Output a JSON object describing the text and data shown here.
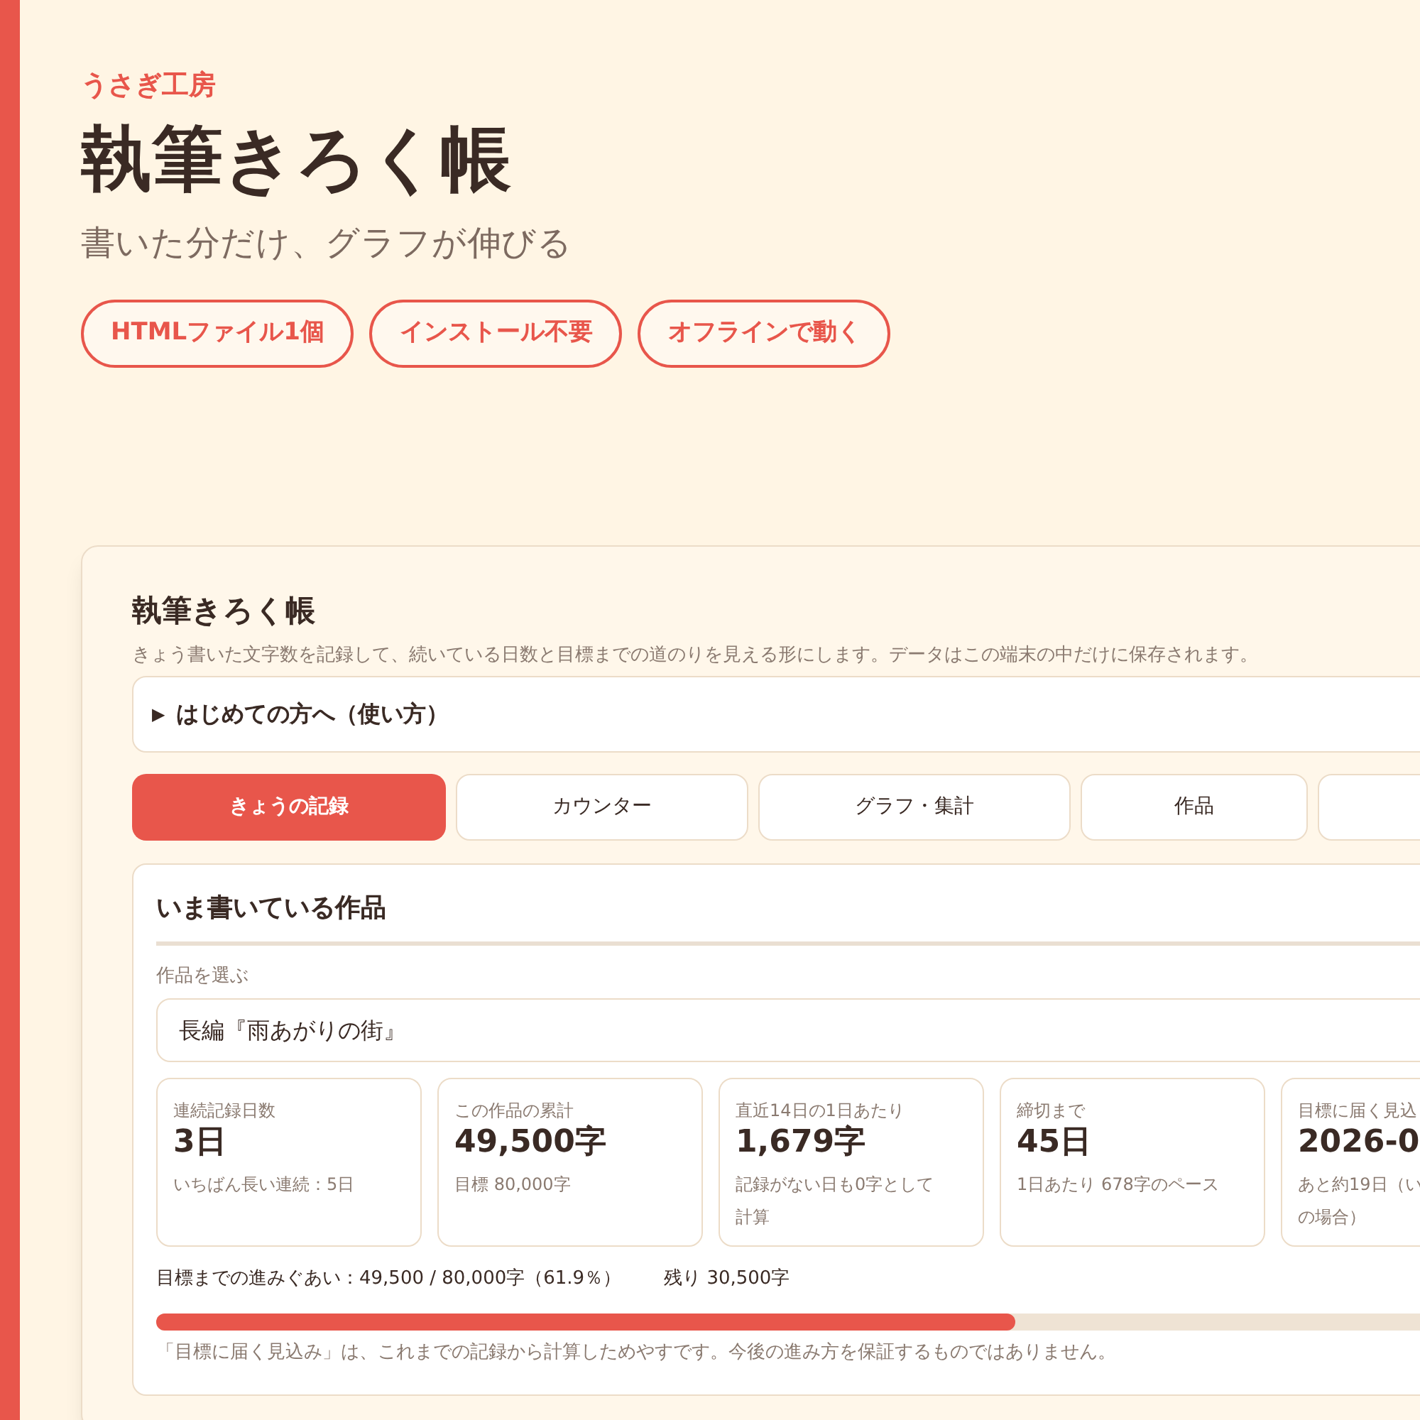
{
  "hero": {
    "brand": "うさぎ工房",
    "title": "執筆きろく帳",
    "subtitle": "書いた分だけ、グラフが伸びる",
    "badges": [
      "HTMLファイル1個",
      "インストール不要",
      "オフラインで動く"
    ]
  },
  "app": {
    "title": "執筆きろく帳",
    "description": "きょう書いた文字数を記録して、続いている日数と目標までの道のりを見える形にします。データはこの端末の中だけに保存されます。",
    "help": {
      "marker": "▶",
      "label": "はじめての方へ（使い方）"
    },
    "tabs": [
      {
        "label": "きょうの記録",
        "selected": true
      },
      {
        "label": "カウンター",
        "selected": false
      },
      {
        "label": "グラフ・集計",
        "selected": false
      },
      {
        "label": "作品",
        "selected": false
      },
      {
        "selected": false
      }
    ],
    "section": {
      "heading": "いま書いている作品",
      "select_label": "作品を選ぶ",
      "select_value": "長編『雨あがりの街』",
      "stats": [
        {
          "label": "連続記録日数",
          "value": "3日",
          "note": [
            "いちばん長い連続：5日"
          ]
        },
        {
          "label": "この作品の累計",
          "value": "49,500字",
          "note": [
            "目標 80,000字"
          ]
        },
        {
          "label": "直近14日の1日あたり",
          "value": "1,679字",
          "note": [
            "記録がない日も0字として",
            "計算"
          ]
        },
        {
          "label": "締切まで",
          "value": "45日",
          "note": [
            "1日あたり 678字のペース"
          ]
        },
        {
          "label": "目標に届く見込",
          "value": "2026-0",
          "note": [
            "あと約19日（い",
            "の場合）"
          ]
        }
      ],
      "progress_text": "目標までの進みぐあい：49,500 / 80,000字（61.9％）",
      "remaining": "残り 30,500字",
      "progress": {
        "level": 0.619
      },
      "footnote": "「目標に届く見込み」は、これまでの記録から計算しためやすです。今後の進み方を保証するものではありません。"
    }
  }
}
